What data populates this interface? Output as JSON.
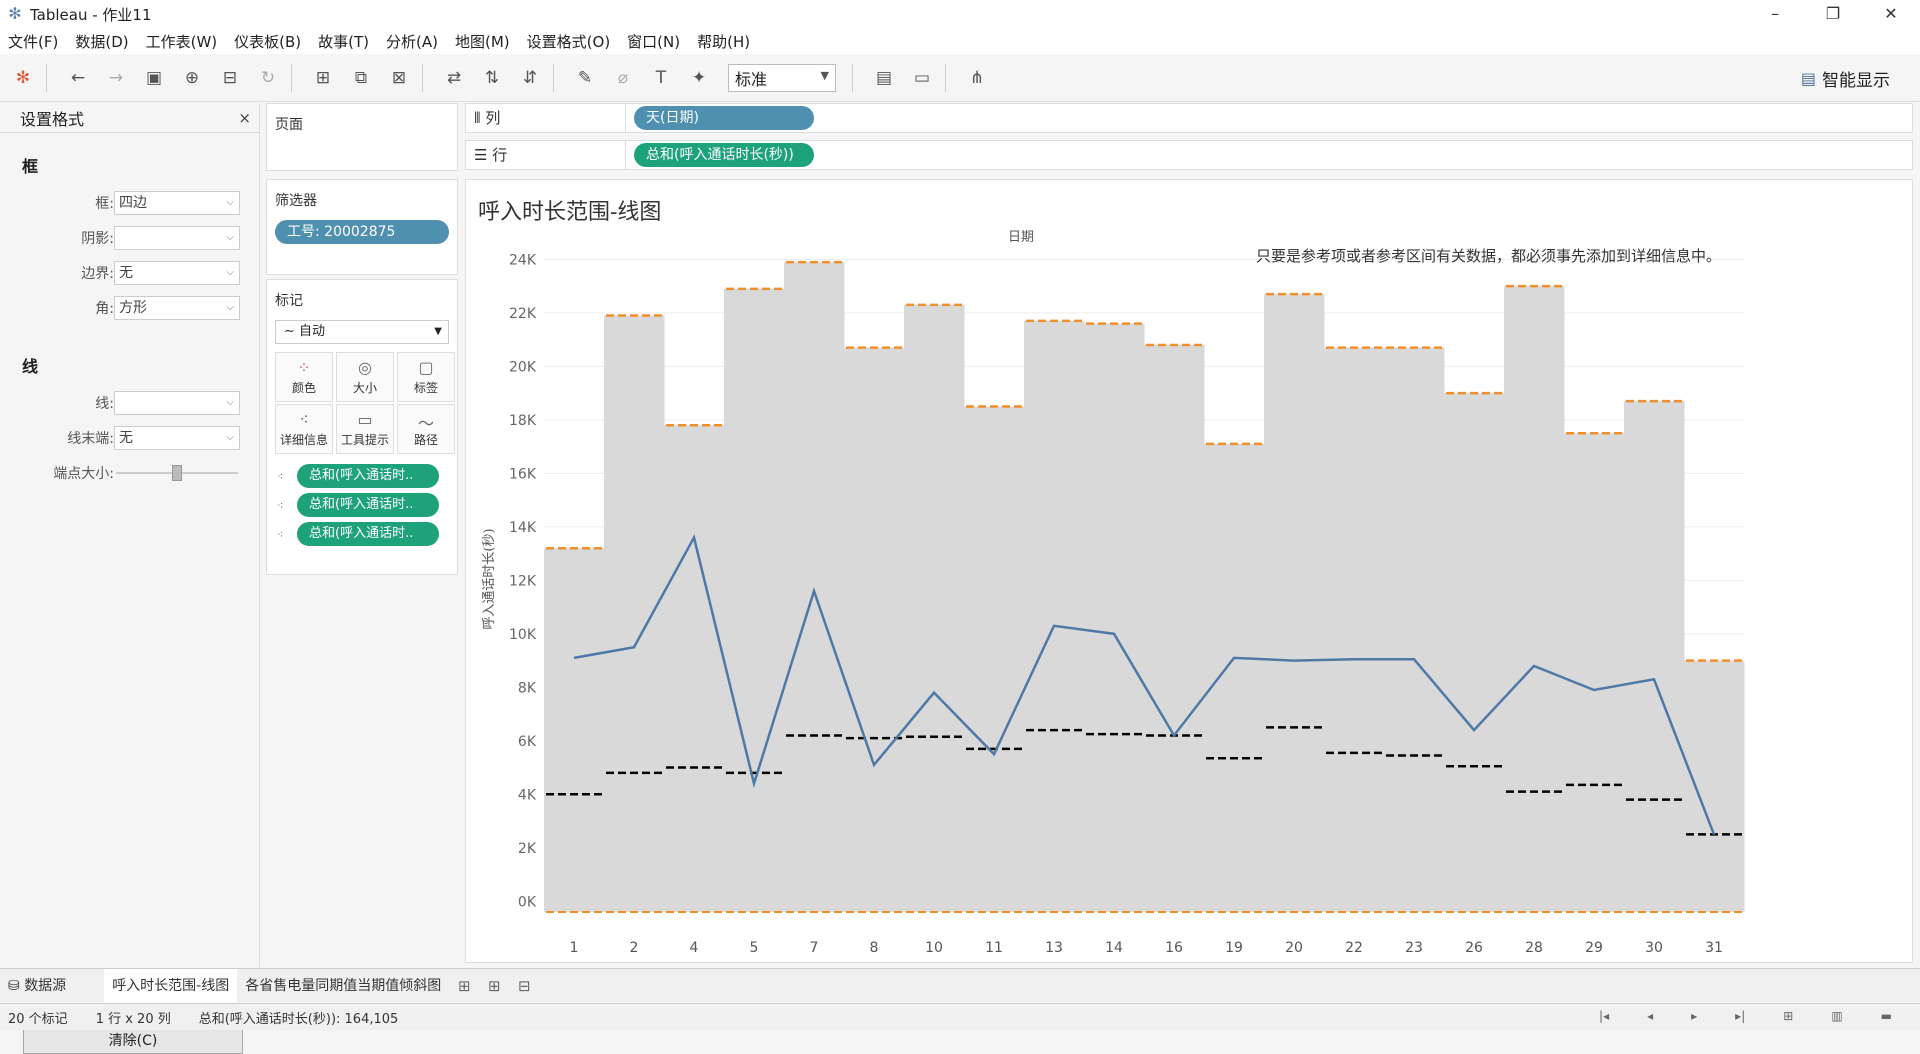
{
  "app": {
    "title": "Tableau - 作业11"
  },
  "window_controls": {
    "minimize": "–",
    "restore": "❐",
    "close": "✕"
  },
  "menu": [
    "文件(F)",
    "数据(D)",
    "工作表(W)",
    "仪表板(B)",
    "故事(T)",
    "分析(A)",
    "地图(M)",
    "设置格式(O)",
    "窗口(N)",
    "帮助(H)"
  ],
  "toolbar": {
    "fit": "标准",
    "show_me": "智能显示"
  },
  "format_panel": {
    "title": "设置格式",
    "close": "×",
    "border_section": "框",
    "border_label": "框:",
    "border_value": "四边",
    "shading_label": "阴影:",
    "shading_value": "",
    "borders_label": "边界:",
    "borders_value": "无",
    "corner_label": "角:",
    "corner_value": "方形",
    "line_section": "线",
    "line_label": "线:",
    "line_value": "",
    "line_end_label": "线末端:",
    "line_end_value": "无",
    "endpoint_size_label": "端点大小:",
    "endpoint_size_level": 0.5,
    "clear_button": "清除(C)"
  },
  "pages": {
    "title": "页面"
  },
  "filters": {
    "title": "筛选器",
    "pill": "工号: 20002875"
  },
  "marks": {
    "title": "标记",
    "type": "自动",
    "cells": [
      "颜色",
      "大小",
      "标签",
      "详细信息",
      "工具提示",
      "路径"
    ],
    "fields": [
      "总和(呼入通话时..",
      "总和(呼入通话时..",
      "总和(呼入通话时.."
    ]
  },
  "shelves": {
    "columns_label": "列",
    "columns_pill": "天(日期)",
    "rows_label": "行",
    "rows_pill": "总和(呼入通话时长(秒))"
  },
  "sheet_tabs": {
    "datasource": "数据源",
    "active": "呼入时长范围-线图",
    "other": "各省售电量同期值当期值倾斜图"
  },
  "status": {
    "marks": "20 个标记",
    "dims": "1 行 x 20 列",
    "sum": "总和(呼入通话时长(秒)): 164,105"
  },
  "colors": {
    "line": "#4e79a7",
    "band": "#d9d9d9",
    "max_ref": "#f28e2b",
    "avg_ref": "#000000",
    "pill_blue": "#4f8faf",
    "pill_green": "#1ea27a"
  },
  "chart_data": {
    "type": "line",
    "title": "呼入时长范围-线图",
    "xlabel": "日期",
    "ylabel": "呼入通话时长(秒)",
    "annotation": "只要是参考项或者参考区间有关数据，都必须事先添加到详细信息中。",
    "categories": [
      "1",
      "2",
      "4",
      "5",
      "7",
      "8",
      "10",
      "11",
      "13",
      "14",
      "16",
      "19",
      "20",
      "22",
      "23",
      "26",
      "28",
      "29",
      "30",
      "31"
    ],
    "y_ticks": [
      "0K",
      "2K",
      "4K",
      "6K",
      "8K",
      "10K",
      "12K",
      "14K",
      "16K",
      "18K",
      "20K",
      "22K",
      "24K"
    ],
    "ylim": [
      -700,
      24800
    ],
    "series": [
      {
        "name": "",
        "role": "line",
        "values": [
          9100,
          9500,
          13600,
          4400,
          11600,
          5100,
          7800,
          5500,
          10300,
          10000,
          6200,
          9100,
          9000,
          9050,
          9050,
          6400,
          8800,
          7900,
          8300,
          2500
        ]
      },
      {
        "name": "",
        "role": "band_max",
        "values": [
          13200,
          21900,
          17800,
          22900,
          23900,
          20700,
          22300,
          18500,
          21700,
          21600,
          20800,
          17100,
          22700,
          20700,
          20700,
          19000,
          23000,
          17500,
          18700,
          9000
        ]
      },
      {
        "name": "",
        "role": "reference_avg",
        "values": [
          4000,
          4800,
          5000,
          4800,
          6200,
          6100,
          6150,
          5700,
          6400,
          6250,
          6200,
          5350,
          6500,
          5550,
          5450,
          5050,
          4100,
          4350,
          3800,
          2500
        ]
      },
      {
        "name": "",
        "role": "band_min",
        "values": [
          -400,
          -400,
          -400,
          -400,
          -400,
          -400,
          -400,
          -400,
          -400,
          -400,
          -400,
          -400,
          -400,
          -400,
          -400,
          -400,
          -400,
          -400,
          -400,
          -400
        ]
      }
    ],
    "grid": true
  }
}
